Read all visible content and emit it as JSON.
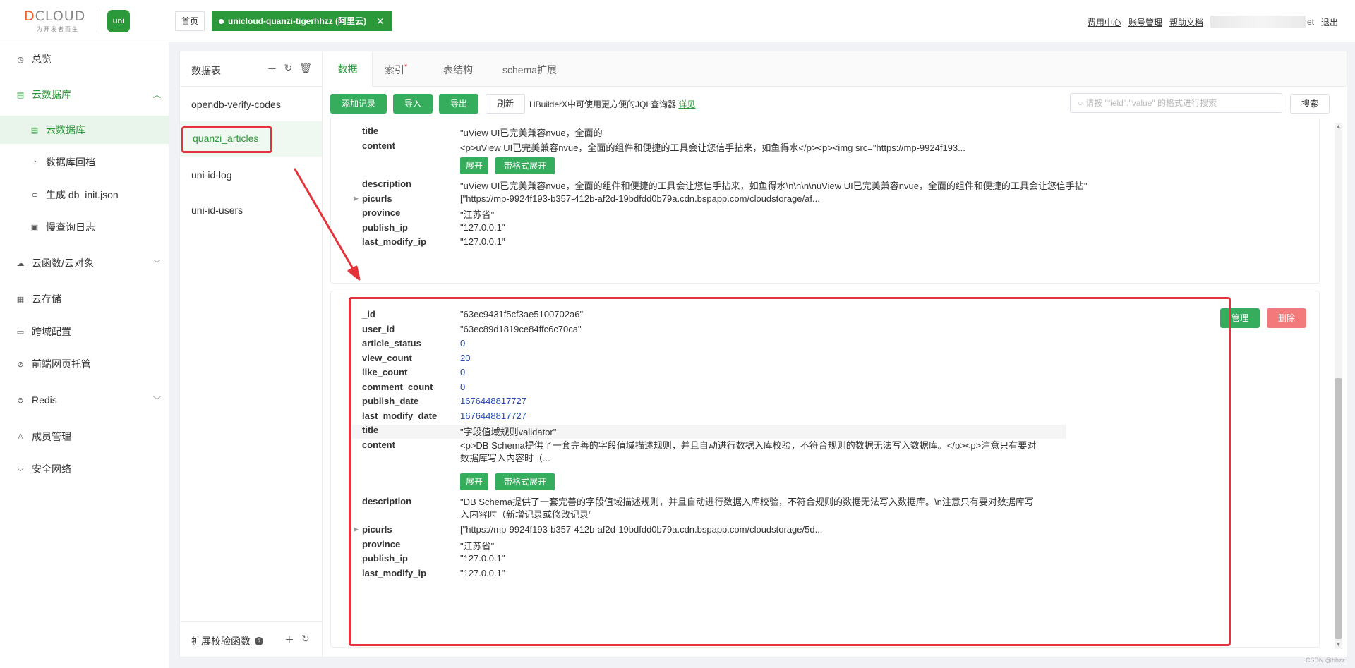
{
  "header": {
    "logo_text_a": "D",
    "logo_text_b": "CLOUD",
    "logo_sub": "为开发者而生",
    "uni_logo": "uni",
    "home_tab": "首页",
    "space_tab": "unicloud-quanzi-tigerhhzz (阿里云)",
    "close_glyph": "✕",
    "links": [
      "费用中心",
      "账号管理",
      "帮助文档"
    ],
    "user_suffix": "et",
    "logout": "退出"
  },
  "sidebar": {
    "items": [
      {
        "label": "总览",
        "icon": "dashboard-icon"
      },
      {
        "label": "云数据库",
        "icon": "database-icon"
      },
      {
        "label": "云数据库",
        "icon": "table-icon"
      },
      {
        "label": "数据库回档",
        "icon": "rollback-icon"
      },
      {
        "label": "生成 db_init.json",
        "icon": "generate-icon"
      },
      {
        "label": "慢查询日志",
        "icon": "log-icon"
      },
      {
        "label": "云函数/云对象",
        "icon": "cloud-icon"
      },
      {
        "label": "云存储",
        "icon": "storage-icon"
      },
      {
        "label": "跨域配置",
        "icon": "cors-icon"
      },
      {
        "label": "前端网页托管",
        "icon": "hosting-icon"
      },
      {
        "label": "Redis",
        "icon": "redis-icon"
      },
      {
        "label": "成员管理",
        "icon": "members-icon"
      },
      {
        "label": "安全网络",
        "icon": "security-icon"
      }
    ]
  },
  "tables_panel": {
    "title": "数据表",
    "tables": [
      "opendb-verify-codes",
      "quanzi_articles",
      "uni-id-log",
      "uni-id-users"
    ],
    "ext_label": "扩展校验函数"
  },
  "tabs": [
    "数据",
    "索引",
    "表结构",
    "schema扩展"
  ],
  "toolbar": {
    "add": "添加记录",
    "import": "导入",
    "export": "导出",
    "refresh": "刷新",
    "tip": "HBuilderX中可使用更方便的JQL查询器",
    "tip_link": "详见",
    "search_placeholder": "请按 \"field\":\"value\" 的格式进行搜索",
    "search": "搜索"
  },
  "record1": {
    "title_val": "\"uView UI已完美兼容nvue，全面的",
    "content_val": "<p>uView UI已完美兼容nvue，全面的组件和便捷的工具会让您信手拈来，如鱼得水</p><p><img src=\"https://mp-9924f193...",
    "description_val": "\"uView UI已完美兼容nvue，全面的组件和便捷的工具会让您信手拈来，如鱼得水\\n\\n\\n\\nuView UI已完美兼容nvue，全面的组件和便捷的工具会让您信手拈\"",
    "picurls_val": "[\"https://mp-9924f193-b357-412b-af2d-19bdfdd0b79a.cdn.bspapp.com/cloudstorage/af...",
    "province_val": "\"江苏省\"",
    "publish_ip_val": "\"127.0.0.1\"",
    "last_modify_ip_val": "\"127.0.0.1\""
  },
  "record2": {
    "id_val": "\"63ec9431f5cf3ae5100702a6\"",
    "user_id_val": "\"63ec89d1819ce84ffc6c70ca\"",
    "article_status_val": "0",
    "view_count_val": "20",
    "like_count_val": "0",
    "comment_count_val": "0",
    "publish_date_val": "1676448817727",
    "last_modify_date_val": "1676448817727",
    "title_val": "\"字段值域规则validator\"",
    "content_val": "<p>DB Schema提供了一套完善的字段值域描述规则，并且自动进行数据入库校验，不符合规则的数据无法写入数据库。</p><p>注意只有要对数据库写入内容时（...",
    "description_val": "\"DB Schema提供了一套完善的字段值域描述规则，并且自动进行数据入库校验，不符合规则的数据无法写入数据库。\\n注意只有要对数据库写入内容时（新增记录或修改记录\"",
    "picurls_val": "[\"https://mp-9924f193-b357-412b-af2d-19bdfdd0b79a.cdn.bspapp.com/cloudstorage/5d...",
    "province_val": "\"江苏省\"",
    "publish_ip_val": "\"127.0.0.1\"",
    "last_modify_ip_val": "\"127.0.0.1\""
  },
  "keys": {
    "id": "_id",
    "user_id": "user_id",
    "article_status": "article_status",
    "view_count": "view_count",
    "like_count": "like_count",
    "comment_count": "comment_count",
    "publish_date": "publish_date",
    "last_modify_date": "last_modify_date",
    "title": "title",
    "content": "content",
    "description": "description",
    "picurls": "picurls",
    "province": "province",
    "publish_ip": "publish_ip",
    "last_modify_ip": "last_modify_ip"
  },
  "actions": {
    "expand": "展开",
    "expand_fmt": "带格式展开",
    "manage": "管理",
    "delete": "删除"
  },
  "watermark": "CSDN @hhzz",
  "colors": {
    "brand_green": "#2b9939",
    "button_green": "#35ad5c",
    "annotation_red": "#e5333b",
    "delete_red": "#f37a7a",
    "number_blue": "#2046b8"
  }
}
